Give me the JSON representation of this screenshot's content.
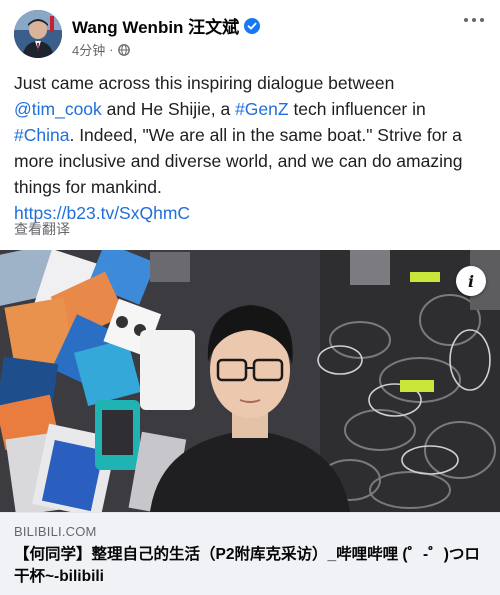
{
  "post": {
    "author_name": "Wang Wenbin 汪文斌",
    "timestamp": "4分钟",
    "privacy_icon": "globe-icon",
    "text": {
      "line1": "Just came across this inspiring dialogue between",
      "mention": "@tim_cook",
      "and_he": " and He Shijie, a ",
      "hashtag_genz": "#GenZ",
      "tech_influencer": " tech influencer in",
      "hashtag_china": "#China",
      "rest": ". Indeed, \"We are all in the same boat.\" Strive for a more inclusive and diverse world, and we can do amazing things for mankind."
    },
    "link_url": "https://b23.tv/SxQhmC",
    "translate_label": "查看翻译"
  },
  "link_card": {
    "domain": "BILIBILI.COM",
    "title": "【何同学】整理自己的生活（P2附库克采访）_哔哩哔哩 (゜-゜)つロ 干杯~-bilibili"
  },
  "colors": {
    "link": "#216fdb",
    "verified": "#1877f2",
    "muted": "#65676b",
    "card_bg": "#f0f2f5"
  }
}
